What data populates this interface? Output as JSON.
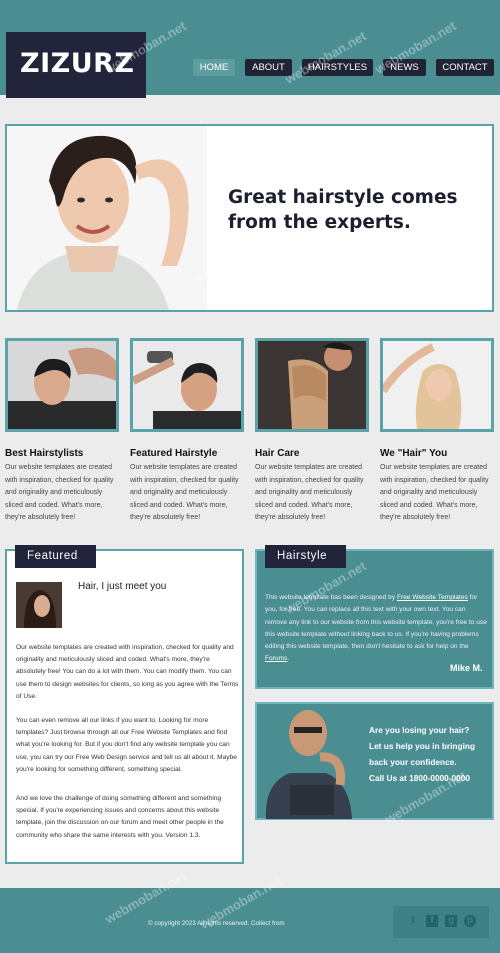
{
  "header": {
    "logo": "ZIZURZ",
    "nav": [
      {
        "label": "HOME",
        "active": true
      },
      {
        "label": "ABOUT",
        "active": false
      },
      {
        "label": "HAIRSTYLES",
        "active": false
      },
      {
        "label": "NEWS",
        "active": false
      },
      {
        "label": "CONTACT",
        "active": false
      }
    ]
  },
  "hero": {
    "title_line1": "Great hairstyle comes",
    "title_line2": "from the experts."
  },
  "columns": [
    {
      "title": "Best Hairstylists",
      "text": "Our website templates are created with inspiration, checked for quality and originality and meticulously sliced and coded. What's more, they're absolutely free!"
    },
    {
      "title": "Featured Hairstyle",
      "text": "Our website templates are created with inspiration, checked for quality and originality and meticulously sliced and coded. What's more, they're absolutely free!"
    },
    {
      "title": "Hair Care",
      "text": "Our website templates are created with inspiration, checked for quality and originality and meticulously sliced and coded. What's more, they're absolutely free!"
    },
    {
      "title": "We \"Hair\" You",
      "text": "Our website templates are created with inspiration, checked for quality and originality and meticulously sliced and coded. What's more, they're absolutely free!"
    }
  ],
  "featured": {
    "tab": "Featured",
    "heading": "Hair, I just meet you",
    "para1": "Our website templates are created with inspiration, checked for quality and originality and meticulously sliced and coded. What's more, they're absolutely free! You can do a lot with them. You can modify them. You can use them to design websites for clients, so long as you agree with the Terms of Use.",
    "para2": "You can even remove all our links if you want to. Looking for more templates? Just browse through all our Free Website Templates and find what you're looking for. But if you don't find any website template you can use, you can try our Free Web Design service and tell us all about it. Maybe you're looking for something different, something special.",
    "para3": "And we love the challenge of doing something different and something special. If you're experiencing issues and concerns about this website template, join the discussion on our forum and meet other people in the community who share the same interests with you. Version 1.3."
  },
  "hairstyle": {
    "tab": "Hairstyle",
    "text_a": "This website template has been designed by ",
    "link1": "Free Website Templates",
    "text_b": " for you, for free. You can replace all this text with your own text. You can remove any link to our website from this website template, you're free to use this website template without linking back to us. If you're having problems editing this website template, then don't hesitate to ask for help on the ",
    "link2": "Forums",
    "text_c": ".",
    "signature": "Mike M."
  },
  "help": {
    "line1": "Are you losing your hair?",
    "line2": "Let us help you in bringing",
    "line3": "back your confidence.",
    "line4": "Call Us at 1800-0000-0000"
  },
  "footer": {
    "copyright": "© copyright 2023 All rights reserved. Collect from",
    "social": [
      "twitter-icon",
      "facebook-icon",
      "googleplus-icon",
      "pinterest-icon"
    ]
  },
  "watermark": "webmoban.net"
}
